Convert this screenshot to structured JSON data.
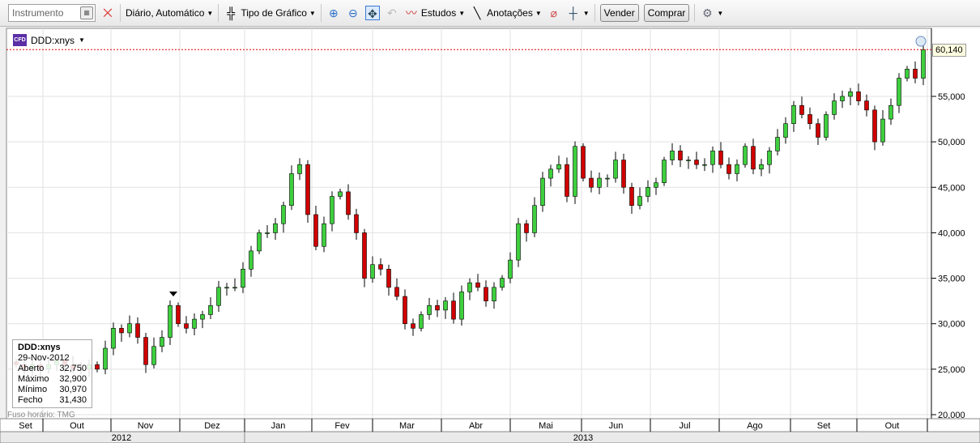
{
  "toolbar": {
    "instrument_placeholder": "Instrumento",
    "period": "Diário,  Automático",
    "chart_type": "Tipo de Gráfico",
    "studies": "Estudos",
    "annotations": "Anotações",
    "sell": "Vender",
    "buy": "Comprar"
  },
  "instrument": {
    "name": "DDD:xnys",
    "badge": "CFD"
  },
  "info_box": {
    "symbol": "DDD:xnys",
    "date": "29-Nov-2012",
    "rows": [
      {
        "label": "Aberto",
        "value": "32,750"
      },
      {
        "label": "Máximo",
        "value": "32,900"
      },
      {
        "label": "Mínimo",
        "value": "30,970"
      },
      {
        "label": "Fecho",
        "value": "31,430"
      }
    ]
  },
  "timezone": "Fuso horário: TMG",
  "last_price": "60,140",
  "colors": {
    "up": "#3ecf3e",
    "down": "#d00000",
    "last_line": "#e00000"
  },
  "chart_data": {
    "type": "candlestick",
    "title": "DDD:xnys",
    "ylim": [
      20000,
      62000
    ],
    "y_ticks": [
      {
        "value": 20000,
        "label": "20,000"
      },
      {
        "value": 25000,
        "label": "25,000"
      },
      {
        "value": 30000,
        "label": "30,000"
      },
      {
        "value": 35000,
        "label": "35,000"
      },
      {
        "value": 40000,
        "label": "40,000"
      },
      {
        "value": 45000,
        "label": "45,000"
      },
      {
        "value": 50000,
        "label": "50,000"
      },
      {
        "value": 55000,
        "label": "55,000"
      }
    ],
    "months": [
      "Set",
      "Out",
      "Nov",
      "Dez",
      "Jan",
      "Fev",
      "Mar",
      "Abr",
      "Mai",
      "Jun",
      "Jul",
      "Ago",
      "Set",
      "Out"
    ],
    "years": [
      "2012",
      "2013"
    ],
    "last_value": 60140,
    "close": [
      25.5,
      25,
      25.5,
      25,
      25.5,
      26,
      25.5,
      25,
      25,
      25.5,
      25,
      27.3,
      29.5,
      29,
      30,
      28.5,
      25.5,
      27.5,
      28.5,
      32,
      30,
      29.5,
      30.5,
      31,
      32,
      34,
      34,
      34,
      36,
      38,
      40,
      40,
      41,
      43,
      46.5,
      47.5,
      42,
      38.5,
      41,
      44,
      44.5,
      42,
      40,
      35,
      36.5,
      36,
      34,
      33,
      30,
      29.5,
      31,
      32,
      31.5,
      32.5,
      30.5,
      33.5,
      34.5,
      34,
      32.5,
      34,
      35,
      37,
      41,
      40,
      43,
      46,
      47,
      47.5,
      44,
      49.5,
      46,
      45,
      46,
      46,
      48,
      45,
      43,
      44,
      45,
      45.5,
      48,
      49,
      48,
      48,
      47.5,
      47.5,
      49,
      47.5,
      46.5,
      47.5,
      49.5,
      47,
      47.5,
      49,
      50.5,
      52,
      54,
      53,
      52,
      50.5,
      53,
      54.5,
      55,
      55.5,
      54.5,
      53.5,
      50,
      52.5,
      54,
      57,
      58,
      57,
      60.14
    ],
    "open_first": 25.8,
    "units": "thousands",
    "wick_pad": 0.7
  }
}
